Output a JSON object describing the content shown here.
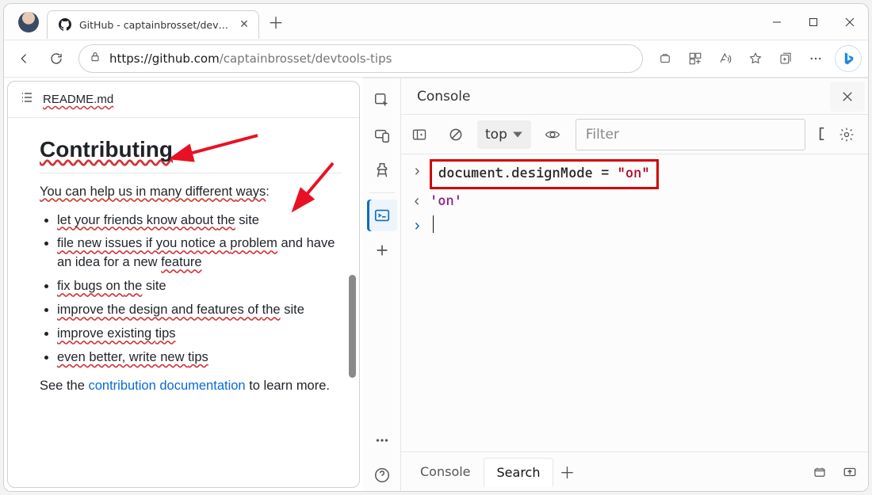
{
  "browser": {
    "tab_title": "GitHub - captainbrosset/devtoo…",
    "url_host": "https://github.com",
    "url_path": "/captainbrosset/devtools-tips"
  },
  "page": {
    "file_name": "README.md",
    "heading": "Contributing",
    "intro_pre": "You can help us in many different ",
    "intro_last": "ways",
    "bullets": {
      "b1_a": "let your friends know about ",
      "b1_b": "the",
      " b1_c": " site",
      "b2_a": "file new issues if you notice a ",
      "b2_b": "problem",
      "b2_c": " and have an idea for a new ",
      "b2_d": "feature",
      "b3_a": "fix bugs on ",
      "b3_b": "the",
      " b3_c": " site",
      "b4_a": "improve the design and features of ",
      "b4_b": "the",
      "b4_c": " site",
      "b5_a": "improve existing ",
      "b5_b": "tips",
      "b6_a": "even better, write new ",
      "b6_b": "tips"
    },
    "outro_pre": "See the ",
    "outro_link": "contribution documentation",
    "outro_post": " to learn more."
  },
  "devtools": {
    "panel_title": "Console",
    "context_label": "top",
    "filter_placeholder": "Filter",
    "input_line": "document.designMode = ",
    "input_value": "\"on\"",
    "result_line": "'on'",
    "drawer_console": "Console",
    "drawer_search": "Search"
  }
}
